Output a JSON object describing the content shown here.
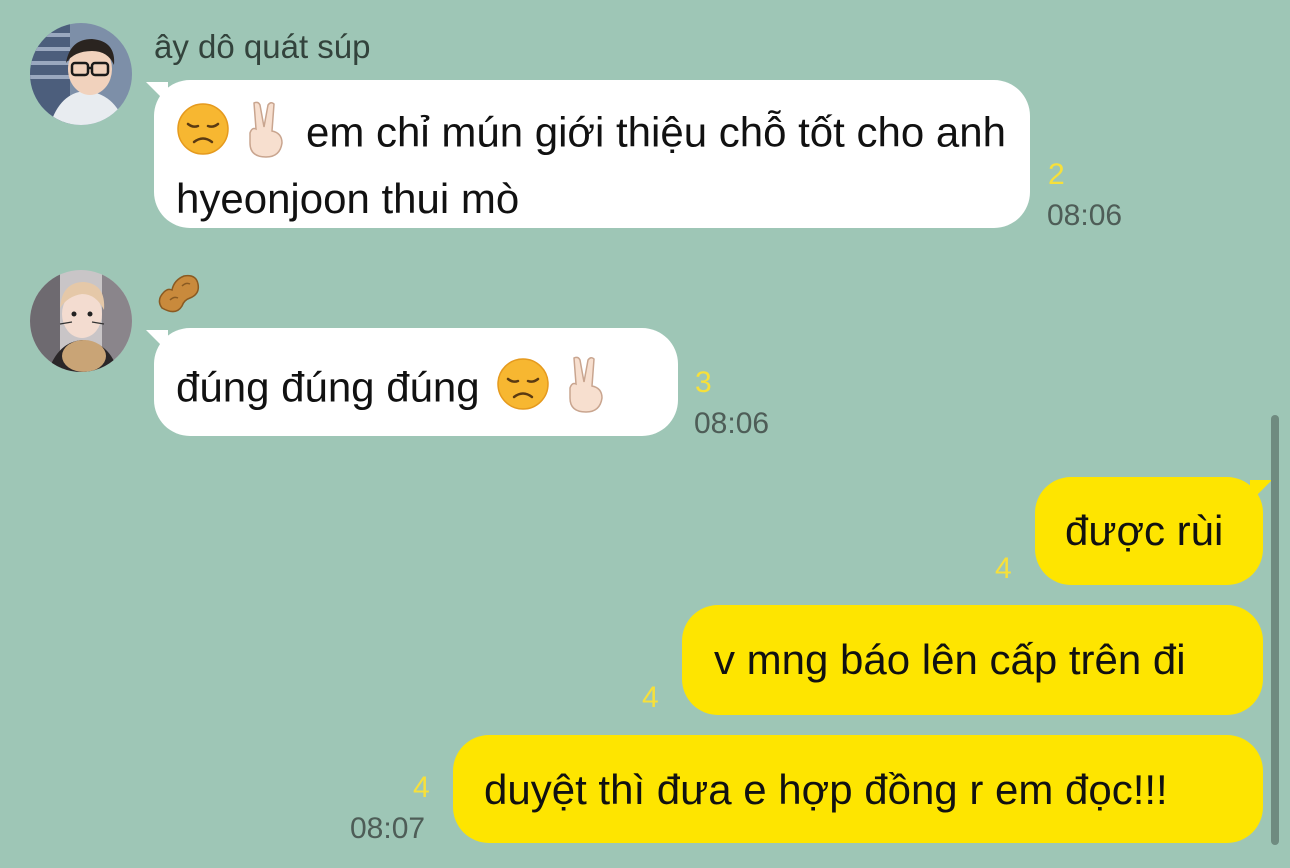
{
  "messages": [
    {
      "sender": "ây dô quát súp",
      "text": "em chỉ mún giới thiệu chỗ tốt cho anh hyeonjoon thui mò",
      "emoji_prefix": [
        "disappointed-face",
        "victory-hand"
      ],
      "unread": "2",
      "time": "08:06"
    },
    {
      "sender_icon": "peanut-icon",
      "text": "đúng đúng đúng",
      "emoji_suffix": [
        "disappointed-face",
        "victory-hand"
      ],
      "unread": "3",
      "time": "08:06"
    },
    {
      "text": "được rùi",
      "unread": "4"
    },
    {
      "text": "v mng báo lên cấp trên đi",
      "unread": "4"
    },
    {
      "text": "duyệt thì đưa e hợp đồng r em đọc!!!",
      "unread": "4",
      "time": "08:07"
    }
  ],
  "colors": {
    "background": "#9ec6b6",
    "incoming_bubble": "#ffffff",
    "outgoing_bubble": "#fee500",
    "unread_count": "#f7e03a",
    "timestamp": "#4e5d57"
  }
}
